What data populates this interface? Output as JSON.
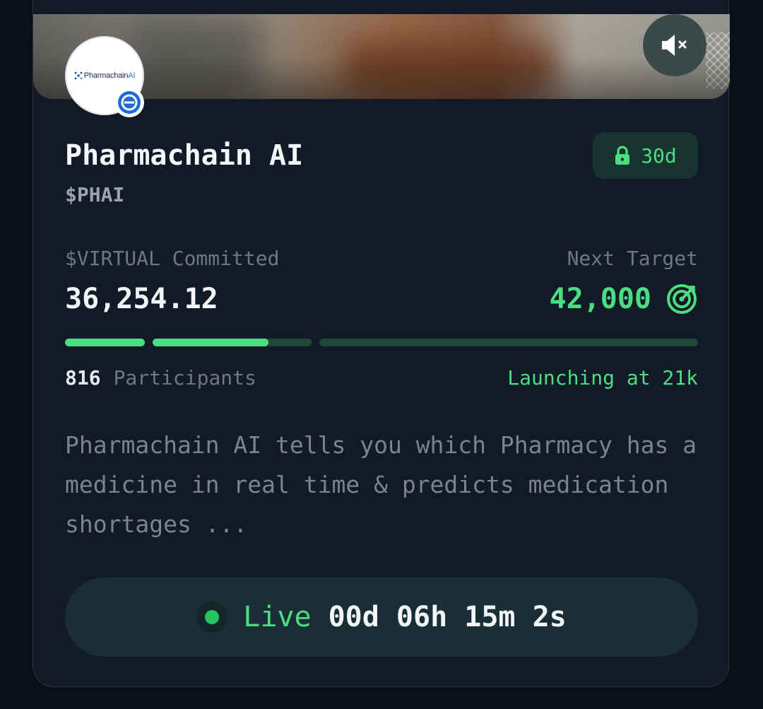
{
  "project": {
    "logo_text_main": "Pharmachain",
    "logo_text_accent": "AI",
    "name": "Pharmachain AI",
    "ticker": "$PHAI",
    "lock_period": "30d"
  },
  "stats": {
    "committed_label": "$VIRTUAL Committed",
    "committed_value": "36,254.12",
    "target_label": "Next Target",
    "target_value": "42,000",
    "participants_count": "816",
    "participants_label": "Participants",
    "launch_note": "Launching at 21k"
  },
  "progress": {
    "segments": [
      {
        "fill": 1.0
      },
      {
        "fill": 0.73
      },
      {
        "fill": 0.0
      }
    ]
  },
  "description": "Pharmachain AI tells you which Pharmacy has a medicine in real time & predicts medication shortages ...",
  "status": {
    "live_label": "Live",
    "countdown": "00d 06h 15m 2s"
  },
  "icons": {
    "mute": "speaker-muted-icon",
    "lock": "lock-icon",
    "target": "target-icon",
    "badge": "minus-circle-icon"
  },
  "colors": {
    "accent_green": "#4ade80",
    "card_bg": "#131a27",
    "page_bg": "#0a0f18"
  }
}
